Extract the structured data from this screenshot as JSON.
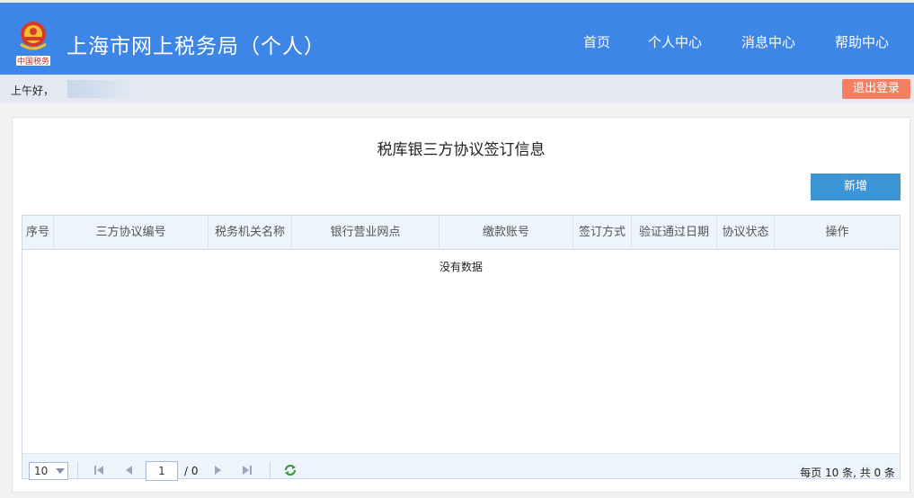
{
  "header": {
    "title": "上海市网上税务局（个人）",
    "nav": [
      {
        "label": "首页"
      },
      {
        "label": "个人中心"
      },
      {
        "label": "消息中心"
      },
      {
        "label": "帮助中心"
      }
    ],
    "emblem_text": "中国税务"
  },
  "greeting": {
    "text": "上午好，",
    "logout_label": "退出登录"
  },
  "main": {
    "title": "税库银三方协议签订信息",
    "add_button": "新增",
    "table": {
      "columns": [
        "序号",
        "三方协议编号",
        "税务机关名称",
        "银行营业网点",
        "缴款账号",
        "签订方式",
        "验证通过日期",
        "协议状态",
        "操作"
      ],
      "rows": [],
      "empty_text": "没有数据"
    },
    "pager": {
      "page_size": "10",
      "page_input": "1",
      "total_pages": "/ 0",
      "info": "每页 10 条, 共 0 条"
    }
  },
  "colors": {
    "header_bg": "#3d86e8",
    "logout_bg": "#f27f62",
    "add_button_bg": "#3b95d6",
    "table_header_bg": "#eef4fb"
  }
}
